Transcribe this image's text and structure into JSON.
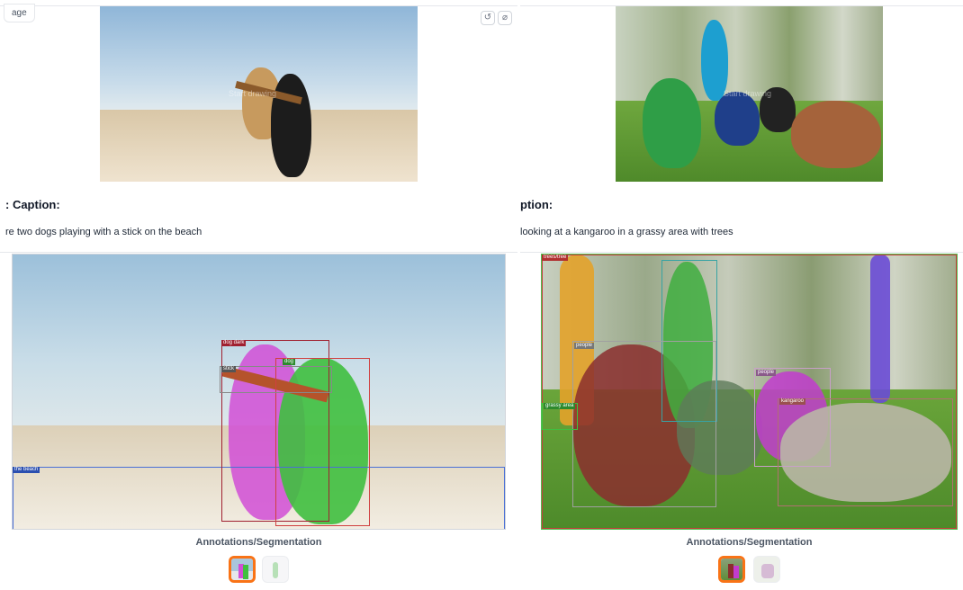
{
  "left": {
    "image_label": "age",
    "caption_heading": ": Caption:",
    "caption_text": "re two dogs playing with a stick on the beach",
    "image_overlay_text": "Start drawing",
    "segmentation_label": "Annotations/Segmentation",
    "tags": [
      "dog dark",
      "stick",
      "dog",
      "the beach"
    ],
    "toolbar_icons": [
      "undo-icon",
      "clear-icon"
    ]
  },
  "right": {
    "caption_heading": "ption:",
    "caption_text": "looking at a kangaroo in a grassy area with trees",
    "image_overlay_text": "Start drawing",
    "segmentation_label": "Annotations/Segmentation",
    "tags": [
      "trees/tree",
      "people",
      "people",
      "kangaroo",
      "grassy area"
    ]
  },
  "colors": {
    "accent": "#f97316",
    "magenta": "#d14dd6",
    "green": "#3fbf3f",
    "brown": "#b5532b",
    "purple": "#6a4bd6",
    "orange_tree": "#e3a22a"
  }
}
